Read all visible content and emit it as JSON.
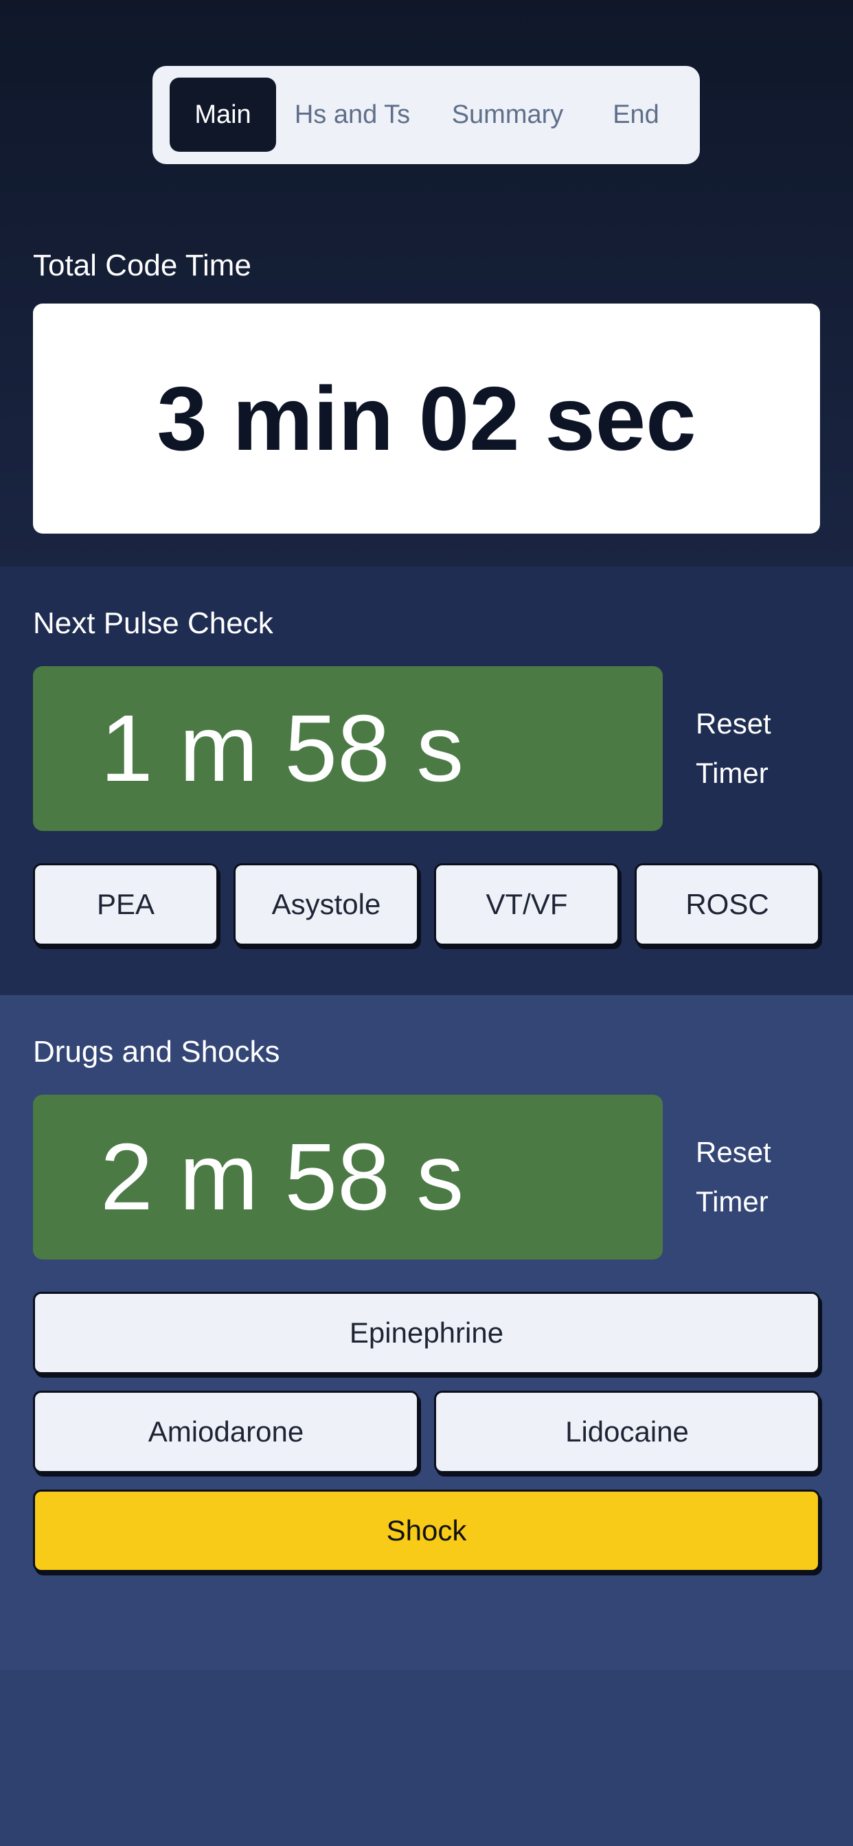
{
  "tabs": {
    "main": "Main",
    "hs_and_ts": "Hs and Ts",
    "summary": "Summary",
    "end": "End",
    "active": "Main"
  },
  "total_code_time": {
    "label": "Total Code Time",
    "value": "3 min 02 sec"
  },
  "pulse_check": {
    "label": "Next Pulse Check",
    "timer": "1 m 58 s",
    "reset_label": "Reset Timer",
    "rhythms": [
      "PEA",
      "Asystole",
      "VT/VF",
      "ROSC"
    ]
  },
  "drugs": {
    "label": "Drugs and Shocks",
    "timer": "2 m 58 s",
    "reset_label": "Reset Timer",
    "epinephrine": "Epinephrine",
    "amiodarone": "Amiodarone",
    "lidocaine": "Lidocaine",
    "shock": "Shock"
  },
  "colors": {
    "timer_green": "#4b7a45",
    "shock_yellow": "#f7cb17",
    "active_tab": "#0f1729"
  }
}
